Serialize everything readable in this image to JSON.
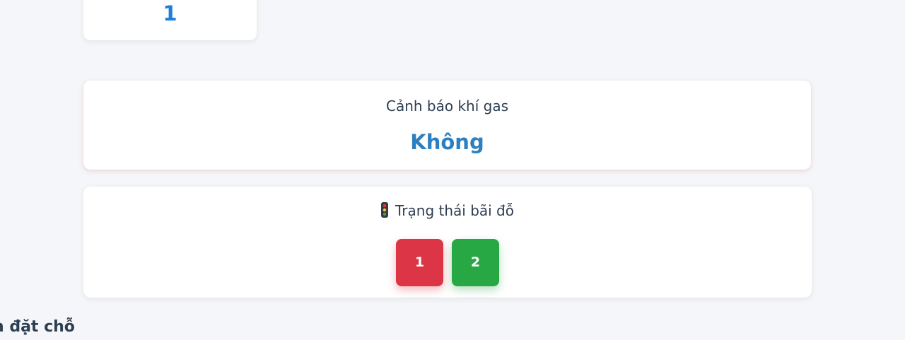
{
  "top_stat": {
    "value": "1"
  },
  "gas_card": {
    "title": "Cảnh báo khí gas",
    "value": "Không",
    "value_color": "#2c7fc0"
  },
  "parking_card": {
    "title": "Trạng thái bãi đỗ",
    "icon": "traffic-light-icon",
    "slots": [
      {
        "label": "1",
        "status": "occupied",
        "color": "#dc3545"
      },
      {
        "label": "2",
        "status": "free",
        "color": "#28a745"
      }
    ]
  },
  "section": {
    "heading": "n đặt chỗ"
  }
}
